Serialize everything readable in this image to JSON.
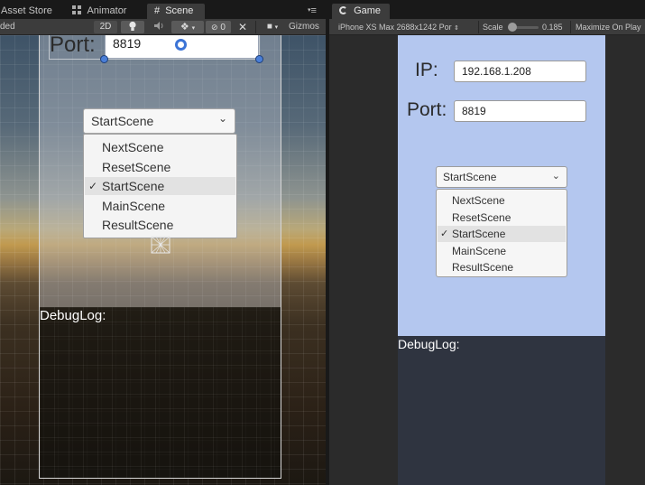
{
  "scene_panel": {
    "tabs": [
      {
        "label": "Asset Store",
        "icon": "asset-store-icon"
      },
      {
        "label": "Animator",
        "icon": "animator-icon"
      },
      {
        "label": "Scene",
        "icon": "grid-icon"
      }
    ],
    "tab_menu": "≡",
    "toolbar": {
      "shading_mode": "ded",
      "mode_2d": "2D",
      "hidden_count": "0",
      "gizmos": "Gizmos"
    },
    "port_label": "Port:",
    "port_value": "8819",
    "dropdown": {
      "selected": "StartScene",
      "options": [
        "NextScene",
        "ResetScene",
        "StartScene",
        "MainScene",
        "ResultScene"
      ]
    },
    "debug_label": "DebugLog:"
  },
  "game_panel": {
    "tab": {
      "label": "Game",
      "icon": "game-icon"
    },
    "toolbar": {
      "device": "iPhone XS Max 2688x1242 Por",
      "scale_label": "Scale",
      "scale_value": "0.185",
      "scale_fraction": 0.07,
      "maximize": "Maximize On Play"
    },
    "ip_label": "IP:",
    "ip_value": "192.168.1.208",
    "port_label": "Port:",
    "port_value": "8819",
    "dropdown": {
      "selected": "StartScene",
      "options": [
        "NextScene",
        "ResetScene",
        "StartScene",
        "MainScene",
        "ResultScene"
      ]
    },
    "debug_label": "DebugLog:"
  },
  "colors": {
    "editor_bg": "#191919",
    "toolbar_bg": "#3c3c3c",
    "game_canvas_top": "#b4c7ef",
    "game_canvas_bottom": "#2f3440",
    "selection_handle": "#4a7fd8"
  }
}
